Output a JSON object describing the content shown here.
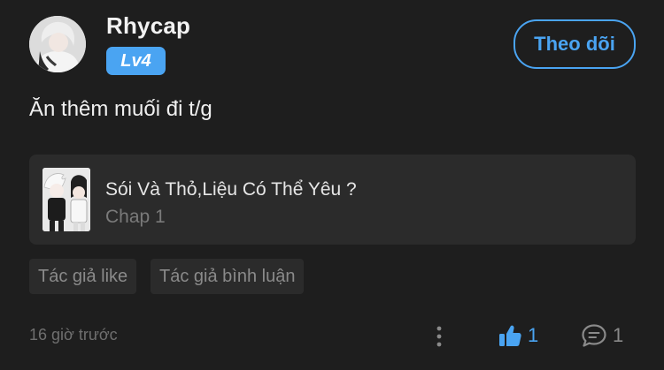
{
  "user": {
    "name": "Rhycap",
    "level": "Lv4",
    "avatar_icon": "user-avatar"
  },
  "follow_label": "Theo dõi",
  "comment": {
    "text": "Ăn thêm muối đi t/g"
  },
  "manga": {
    "title": "Sói Và Thỏ,Liệu Có Thể Yêu ?",
    "chapter": "Chap 1",
    "thumbnail_icon": "manga-cover"
  },
  "tags": [
    {
      "label": "Tác giả like"
    },
    {
      "label": "Tác giả bình luận"
    }
  ],
  "footer": {
    "timestamp": "16 giờ trước",
    "like_count": "1",
    "reply_count": "1"
  },
  "colors": {
    "background": "#1e1e1e",
    "accent": "#4aa4f2",
    "card": "#2b2b2b",
    "muted": "#7a7a7a"
  }
}
